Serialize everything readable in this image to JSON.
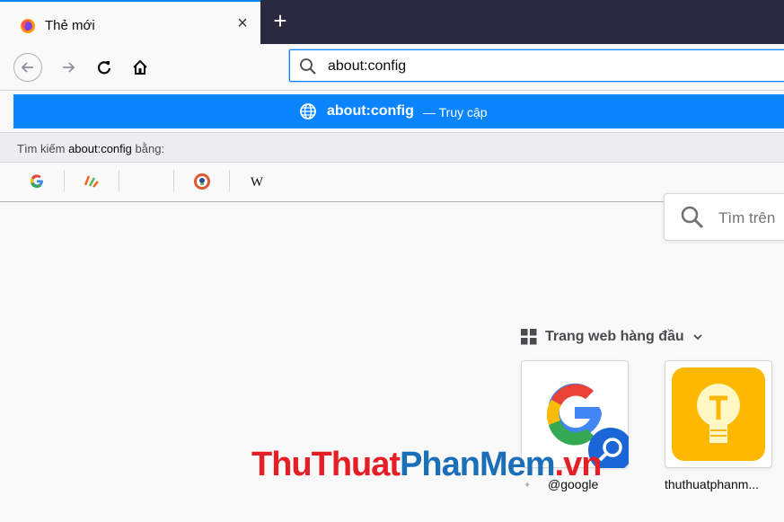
{
  "tab": {
    "title": "Thẻ mới"
  },
  "urlbar": {
    "value": "about:config"
  },
  "dropdown": {
    "result_title": "about:config",
    "result_action": "— Truy cập",
    "search_with_prefix": "Tìm kiếm ",
    "search_with_query": "about:config",
    "search_with_suffix": " bằng:",
    "engines": [
      "google-icon",
      "coccoc-icon",
      "blank-engine",
      "duckduckgo-icon",
      "wikipedia-icon"
    ]
  },
  "content": {
    "search_placeholder": "Tìm trên",
    "section_title": "Trang web hàng đầu",
    "tiles": [
      {
        "label": "@google"
      },
      {
        "label": "thuthuatphanm..."
      }
    ],
    "watermark_a": "ThuThuat",
    "watermark_b": "PhanMem",
    "watermark_c": ".vn"
  },
  "colors": {
    "accent": "#0a84ff",
    "tabbar": "#2a2a3f",
    "watermark_red": "#e61e25",
    "watermark_blue": "#1b6fb8"
  }
}
